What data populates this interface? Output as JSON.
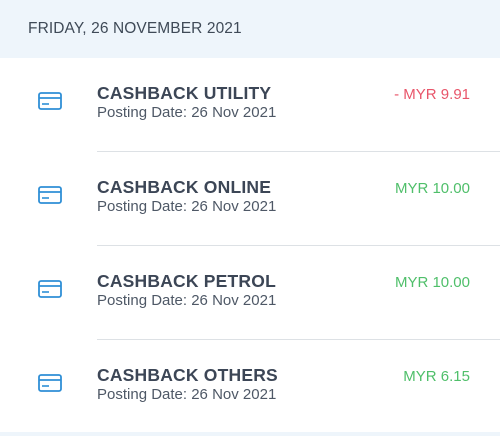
{
  "date_header": "FRIDAY, 26 NOVEMBER 2021",
  "colors": {
    "debit": "#e8556a",
    "credit": "#4fbf6a",
    "icon": "#2f8fd6",
    "header_bg": "#eef5fb"
  },
  "transactions": [
    {
      "title": "CASHBACK UTILITY",
      "posting": "Posting Date: 26 Nov 2021",
      "amount": "- MYR 9.91",
      "type": "debit",
      "icon": "credit-card-icon"
    },
    {
      "title": "CASHBACK ONLINE",
      "posting": "Posting Date: 26 Nov 2021",
      "amount": "MYR 10.00",
      "type": "credit",
      "icon": "credit-card-icon"
    },
    {
      "title": "CASHBACK PETROL",
      "posting": "Posting Date: 26 Nov 2021",
      "amount": "MYR 10.00",
      "type": "credit",
      "icon": "credit-card-icon"
    },
    {
      "title": "CASHBACK OTHERS",
      "posting": "Posting Date: 26 Nov 2021",
      "amount": "MYR 6.15",
      "type": "credit",
      "icon": "credit-card-icon"
    }
  ]
}
